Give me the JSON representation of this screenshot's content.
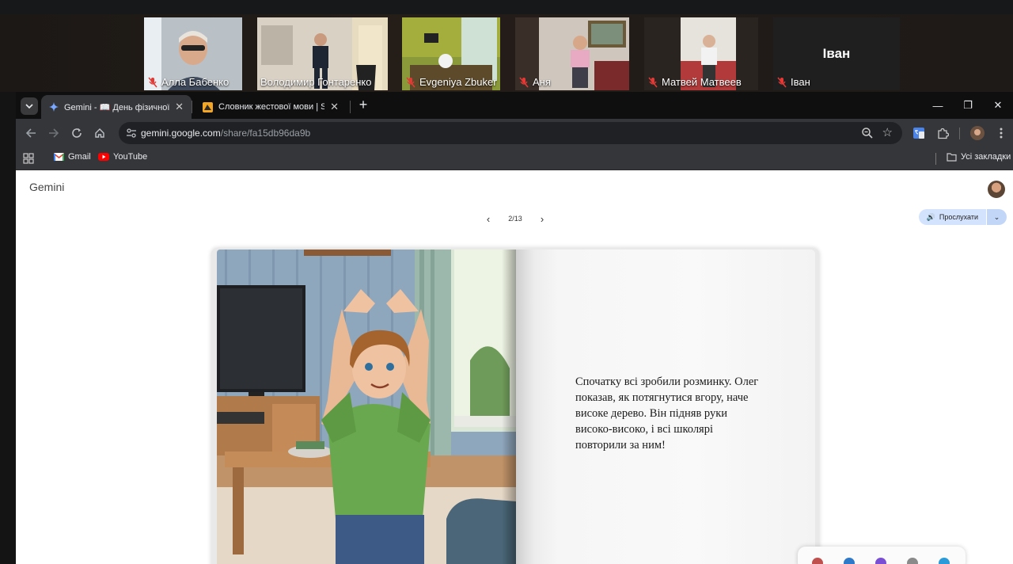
{
  "call": {
    "participants": [
      {
        "name": "Алла Бабенко",
        "muted": true
      },
      {
        "name": "Володимир Гонтаренко",
        "muted": true,
        "active": true
      },
      {
        "name": "Evgeniya Zbuker",
        "muted": true
      },
      {
        "name": "Аня",
        "muted": true
      },
      {
        "name": "Матвей Матвеев",
        "muted": true
      },
      {
        "name": "Іван",
        "muted": true,
        "camera_off": true,
        "big_label": "Іван"
      }
    ]
  },
  "browser": {
    "tabs": [
      {
        "title": "Gemini - 📖 День фізичної ку",
        "close": "✕",
        "active": true
      },
      {
        "title": "Словник жестової мови | Spre",
        "close": "✕",
        "active": false
      }
    ],
    "new_tab": "+",
    "window_controls": {
      "minimize": "—",
      "restore": "❐",
      "close": "✕"
    },
    "address": {
      "host": "gemini.google.com",
      "path": "/share/fa15db96da9b"
    },
    "bookmarks": [
      {
        "label": "Gmail",
        "icon": "gmail-icon"
      },
      {
        "label": "YouTube",
        "icon": "youtube-icon"
      }
    ],
    "all_bookmarks": "Усі закладки"
  },
  "page": {
    "app_name": "Gemini",
    "pager": {
      "current": "2/13",
      "prev": "‹",
      "next": "›"
    },
    "listen_label": "Прослухати",
    "listen_icon": "🔊",
    "listen_more": "⌄",
    "story_text": "Спочатку всі зробили розминку. Олег показав, як потягнутися вгору, наче високе дерево. Він підняв руки високо-високо, і всі школярі повторили за ним!"
  },
  "colors": {
    "active_speaker": "#2ee06a",
    "muted_red": "#e53935",
    "listen_bg": "#d3e3fd"
  }
}
